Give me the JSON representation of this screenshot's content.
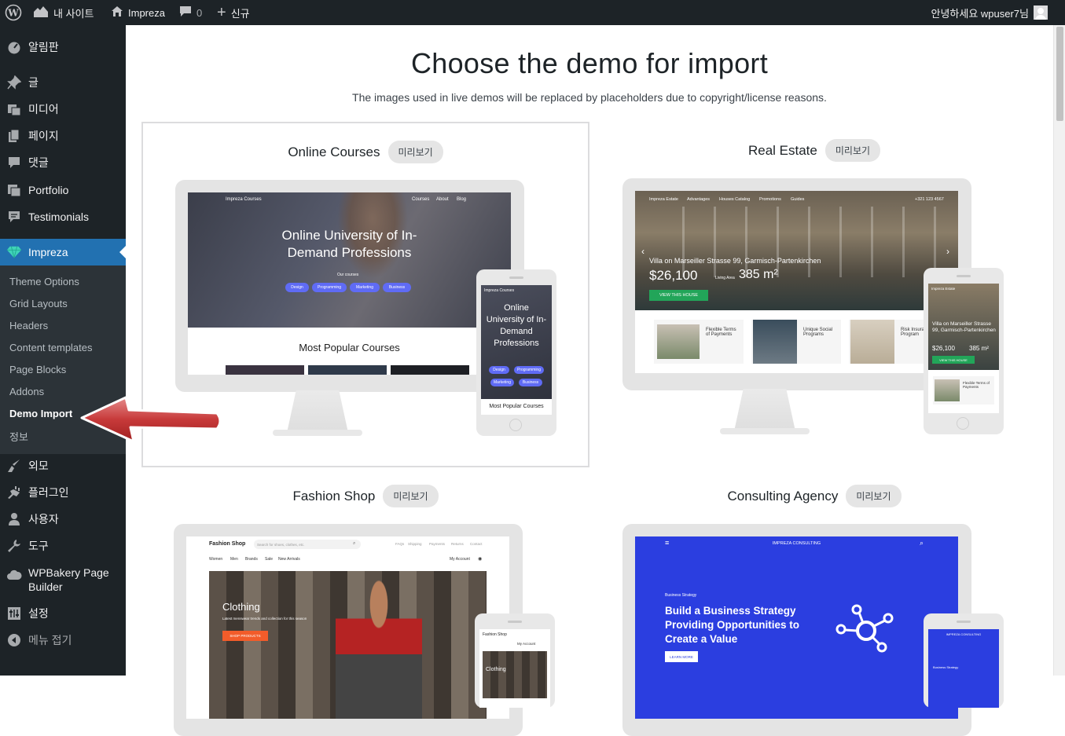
{
  "adminbar": {
    "wp_logo": "wordpress-icon",
    "my_site": "내 사이트",
    "site_name": "Impreza",
    "comments_count": "0",
    "new_label": "신규",
    "greeting": "안녕하세요 wpuser7님"
  },
  "sidebar": {
    "items": [
      {
        "label": "알림판",
        "icon": "dashboard-icon"
      },
      {
        "label": "글",
        "icon": "pin-icon"
      },
      {
        "label": "미디어",
        "icon": "media-icon"
      },
      {
        "label": "페이지",
        "icon": "page-icon"
      },
      {
        "label": "댓글",
        "icon": "comment-icon"
      },
      {
        "label": "Portfolio",
        "icon": "portfolio-icon"
      },
      {
        "label": "Testimonials",
        "icon": "testimonial-icon"
      },
      {
        "label": "Impreza",
        "icon": "diamond-icon"
      },
      {
        "label": "외모",
        "icon": "brush-icon"
      },
      {
        "label": "플러그인",
        "icon": "plugin-icon"
      },
      {
        "label": "사용자",
        "icon": "user-icon"
      },
      {
        "label": "도구",
        "icon": "wrench-icon"
      },
      {
        "label": "WPBakery Page Builder",
        "icon": "cloud-icon"
      },
      {
        "label": "설정",
        "icon": "settings-icon"
      },
      {
        "label": "메뉴 접기",
        "icon": "collapse-icon"
      }
    ],
    "submenu": [
      "Theme Options",
      "Grid Layouts",
      "Headers",
      "Content templates",
      "Page Blocks",
      "Addons",
      "Demo Import",
      "정보"
    ]
  },
  "main": {
    "title": "Choose the demo for import",
    "subtitle": "The images used in live demos will be replaced by placeholders due to copyright/license reasons.",
    "preview_label": "미리보기",
    "demos": [
      {
        "title": "Online Courses",
        "nav_brand": "Impreza Courses",
        "nav_links": [
          "Courses",
          "About",
          "Blog"
        ],
        "hero": "Online University of In-Demand Professions",
        "hero_small": "Our courses",
        "tags": [
          "Design",
          "Programming",
          "Marketing",
          "Business"
        ],
        "section": "Most Popular Courses",
        "phone_brand": "Impreza Courses",
        "phone_hero": "Online University of In-Demand Professions",
        "phone_section": "Most Popular Courses"
      },
      {
        "title": "Real Estate",
        "nav_brand": "Impreza Estate",
        "nav_links": [
          "Advantages",
          "Houses Catalog",
          "Promotions",
          "Guides"
        ],
        "phone_number": "+321 123 4567",
        "listing": "Villa on Marseiller Strasse 99, Garmisch-Partenkirchen",
        "price": "$26,100",
        "area_label": "Living Area",
        "area": "385 m²",
        "cta": "VIEW THIS HOUSE",
        "features": [
          "Flexible Terms of Payments",
          "Unique Social Programs",
          "Risk Insurance Program"
        ],
        "phone_brand": "Impreza Estate",
        "phone_listing": "Villa on Marseiller Strasse 99, Garmisch-Partenkirchen",
        "phone_price": "$26,100",
        "phone_area": "385 m²",
        "phone_cta": "VIEW THIS HOUSE",
        "phone_feature": "Flexible Terms of Payments"
      },
      {
        "title": "Fashion Shop",
        "brand": "Fashion Shop",
        "search_placeholder": "Search for shoes, clothes, etc.",
        "top_links": [
          "FAQs",
          "Shipping",
          "Payments",
          "Returns",
          "Contact"
        ],
        "cats": [
          "Women",
          "Men",
          "Brands",
          "Sale",
          "New Arrivals"
        ],
        "account": "My Account",
        "hero": "Clothing",
        "hero_text": "Latest menswear trends and collection for this season",
        "cta": "SHOP PRODUCTS",
        "phone_brand": "Fashion Shop",
        "phone_account": "My Account",
        "phone_hero": "Clothing"
      },
      {
        "title": "Consulting Agency",
        "brand": "IMPREZA CONSULTING",
        "kicker": "Business Strategy",
        "hero": "Build a Business Strategy Providing Opportunities to Create a Value",
        "cta": "LEARN MORE",
        "phone_brand": "IMPREZA CONSULTING",
        "phone_kicker": "Business Strategy"
      }
    ]
  },
  "colors": {
    "admin_bg": "#1d2327",
    "accent": "#2271b1",
    "submenu_bg": "#2c3338"
  }
}
